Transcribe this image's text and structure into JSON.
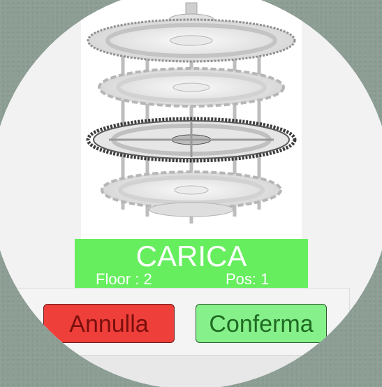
{
  "banner": {
    "title": "CARICA",
    "floor_label": "Floor : 2",
    "pos_label": "Pos: 1",
    "color": "#66ee5e"
  },
  "buttons": {
    "cancel_label": "Annulla",
    "confirm_label": "Conferma",
    "cancel_color": "#ef3f3a",
    "confirm_color": "#86f08a"
  },
  "image": {
    "subject": "carousel-gear-assembly-render"
  }
}
